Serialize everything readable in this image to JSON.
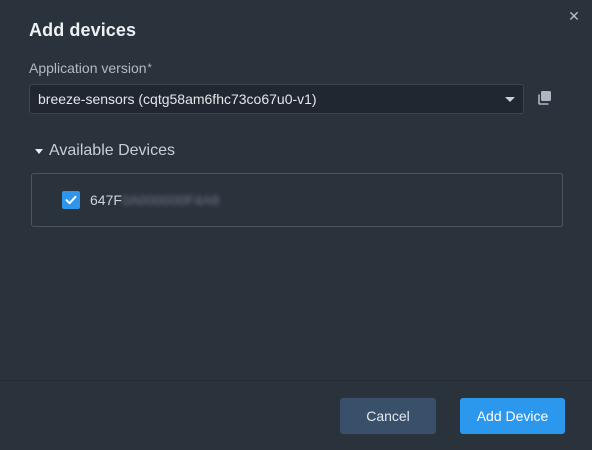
{
  "dialog": {
    "title": "Add devices",
    "close_glyph": "✕",
    "close_icon": "close-icon"
  },
  "app_version": {
    "label": "Application version",
    "required_mark": "*",
    "selected_value": "breeze-sensors (cqtg58am6fhc73co67u0-v1)",
    "caret_icon": "chevron-down-icon",
    "copy_icon": "copy-icon"
  },
  "devices": {
    "section_label": "Available Devices",
    "toggle_icon": "caret-down-icon",
    "items": [
      {
        "id_visible": "647F",
        "id_redacted": "0A000000F4A8",
        "checked": true
      }
    ]
  },
  "footer": {
    "cancel_label": "Cancel",
    "add_label": "Add Device"
  },
  "colors": {
    "background": "#2a323c",
    "accent": "#2b98ee",
    "secondary_button": "#38506a"
  }
}
